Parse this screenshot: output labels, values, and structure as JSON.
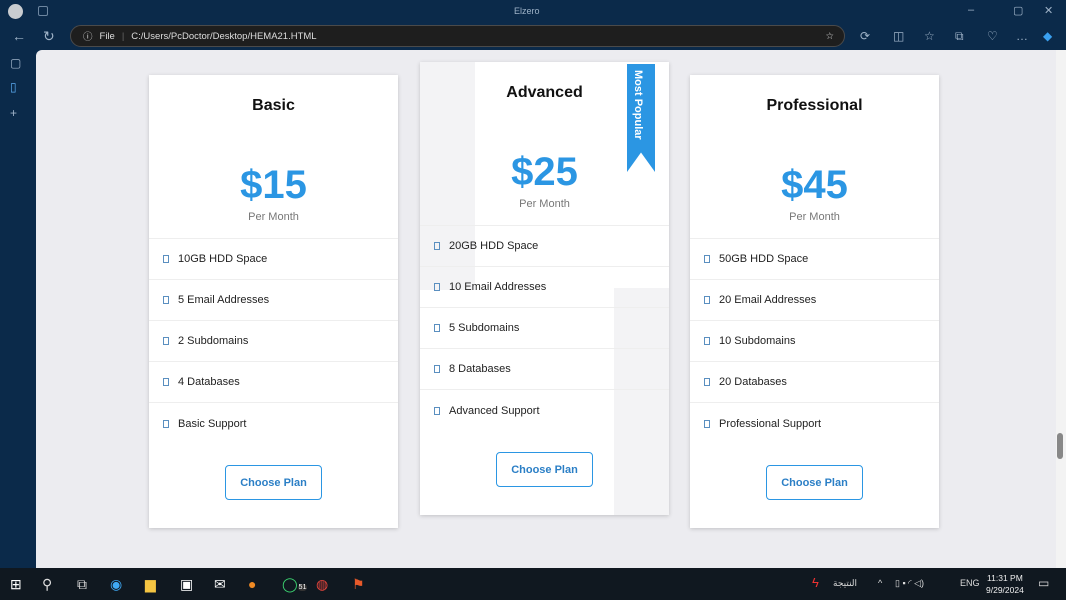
{
  "browser": {
    "window_title": "Elzero",
    "address_prefix": "File",
    "url": "C:/Users/PcDoctor/Desktop/HEMA21.HTML"
  },
  "plans": [
    {
      "name": "Basic",
      "price": "$15",
      "period": "Per Month",
      "features": [
        "10GB HDD Space",
        "5 Email Addresses",
        "2 Subdomains",
        "4 Databases",
        "Basic Support"
      ],
      "button": "Choose Plan"
    },
    {
      "name": "Advanced",
      "price": "$25",
      "period": "Per Month",
      "badge": "Most Popular",
      "features": [
        "20GB HDD Space",
        "10 Email Addresses",
        "5 Subdomains",
        "8 Databases",
        "Advanced Support"
      ],
      "button": "Choose Plan"
    },
    {
      "name": "Professional",
      "price": "$45",
      "period": "Per Month",
      "features": [
        "50GB HDD Space",
        "20 Email Addresses",
        "10 Subdomains",
        "20 Databases",
        "Professional Support"
      ],
      "button": "Choose Plan"
    }
  ],
  "taskbar": {
    "whatsapp_badge": "51",
    "weather": "النتيجة",
    "lang": "ENG",
    "time": "11:31 PM",
    "date": "9/29/2024"
  },
  "colors": {
    "accent": "#2b96e3"
  }
}
